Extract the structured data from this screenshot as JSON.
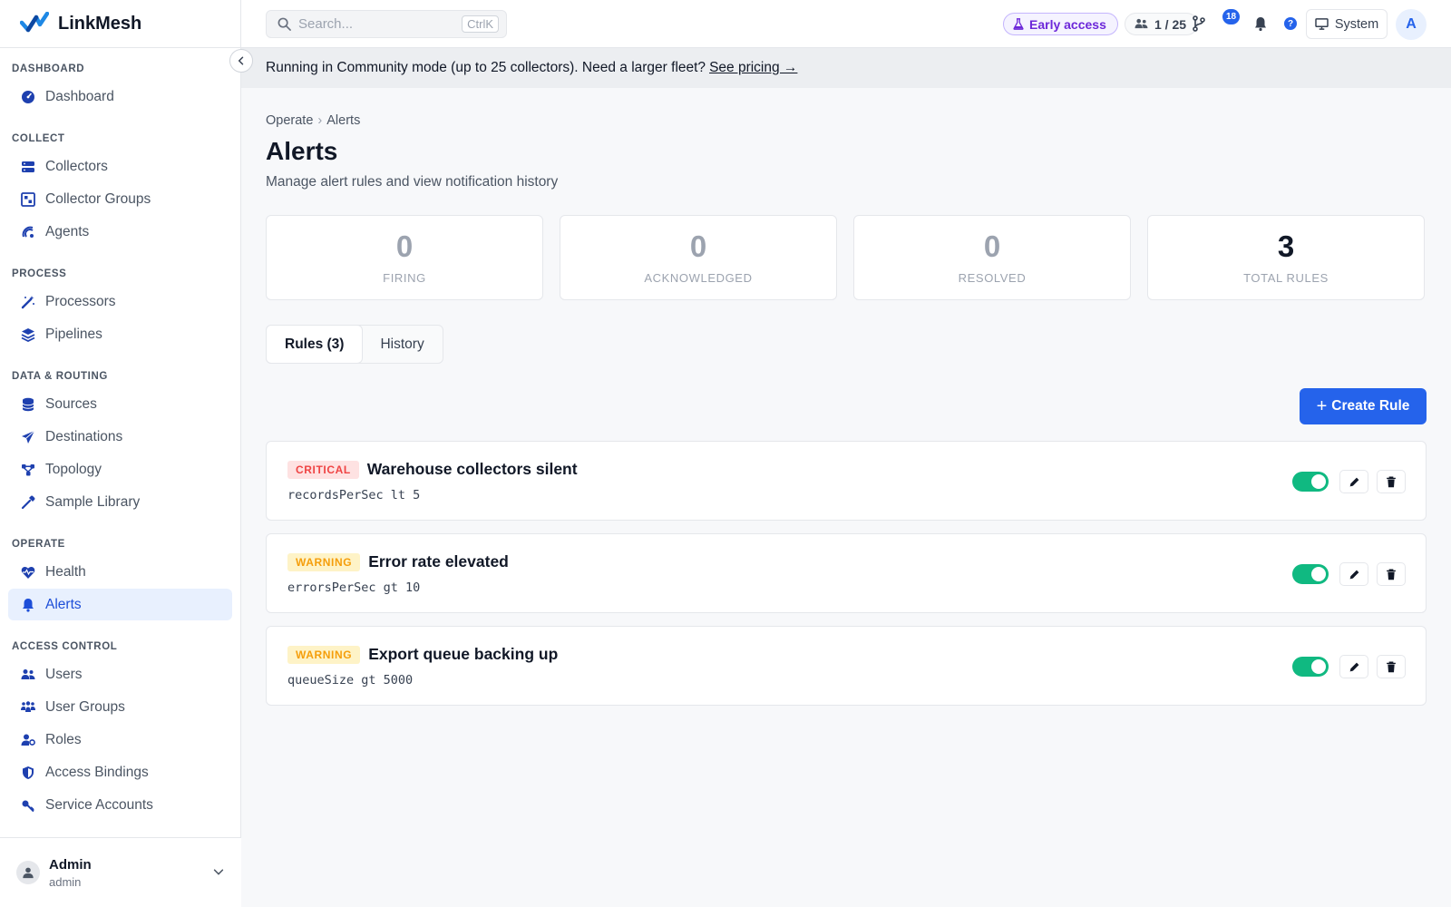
{
  "app": {
    "name": "LinkMesh"
  },
  "sidebar": {
    "sections": [
      {
        "label": "DASHBOARD",
        "items": [
          {
            "label": "Dashboard",
            "icon": "gauge-icon"
          }
        ]
      },
      {
        "label": "COLLECT",
        "items": [
          {
            "label": "Collectors",
            "icon": "server-icon"
          },
          {
            "label": "Collector Groups",
            "icon": "group-frame-icon"
          },
          {
            "label": "Agents",
            "icon": "agent-icon"
          }
        ]
      },
      {
        "label": "PROCESS",
        "items": [
          {
            "label": "Processors",
            "icon": "magic-wand-icon"
          },
          {
            "label": "Pipelines",
            "icon": "layers-icon"
          }
        ]
      },
      {
        "label": "DATA & ROUTING",
        "items": [
          {
            "label": "Sources",
            "icon": "database-icon"
          },
          {
            "label": "Destinations",
            "icon": "paper-plane-icon"
          },
          {
            "label": "Topology",
            "icon": "topology-icon"
          },
          {
            "label": "Sample Library",
            "icon": "eyedropper-icon"
          }
        ]
      },
      {
        "label": "OPERATE",
        "items": [
          {
            "label": "Health",
            "icon": "heart-pulse-icon"
          },
          {
            "label": "Alerts",
            "icon": "bell-icon",
            "active": true
          }
        ]
      },
      {
        "label": "ACCESS CONTROL",
        "items": [
          {
            "label": "Users",
            "icon": "users-icon"
          },
          {
            "label": "User Groups",
            "icon": "user-groups-icon"
          },
          {
            "label": "Roles",
            "icon": "user-key-icon"
          },
          {
            "label": "Access Bindings",
            "icon": "shield-icon"
          },
          {
            "label": "Service Accounts",
            "icon": "key-icon"
          }
        ]
      }
    ],
    "footer": {
      "name": "Admin",
      "username": "admin"
    }
  },
  "topbar": {
    "search_placeholder": "Search...",
    "search_shortcut": "CtrlK",
    "early_access": "Early access",
    "seats": "1 / 25",
    "branch_badge": "18",
    "help_glyph": "?",
    "theme_label": "System",
    "avatar_initial": "A"
  },
  "banner": {
    "text": "Running in Community mode (up to 25 collectors). Need a larger fleet?",
    "link": "See pricing →"
  },
  "breadcrumb": {
    "parent": "Operate",
    "sep": "›",
    "current": "Alerts"
  },
  "page": {
    "title": "Alerts",
    "subtitle": "Manage alert rules and view notification history"
  },
  "stats": [
    {
      "value": "0",
      "label": "FIRING"
    },
    {
      "value": "0",
      "label": "ACKNOWLEDGED"
    },
    {
      "value": "0",
      "label": "RESOLVED"
    },
    {
      "value": "3",
      "label": "TOTAL RULES"
    }
  ],
  "tabs": [
    {
      "label": "Rules (3)",
      "active": true
    },
    {
      "label": "History",
      "active": false
    }
  ],
  "create_button": {
    "plus": "+",
    "label": "Create Rule"
  },
  "rules": [
    {
      "severity": "CRITICAL",
      "severity_kind": "critical",
      "name": "Warehouse collectors silent",
      "condition": "recordsPerSec lt 5",
      "enabled": true
    },
    {
      "severity": "WARNING",
      "severity_kind": "warning",
      "name": "Error rate elevated",
      "condition": "errorsPerSec gt 10",
      "enabled": true
    },
    {
      "severity": "WARNING",
      "severity_kind": "warning",
      "name": "Export queue backing up",
      "condition": "queueSize gt 5000",
      "enabled": true
    }
  ],
  "colors": {
    "accent": "#2563eb",
    "toggle_on": "#10b981",
    "critical": "#ef4444",
    "warning": "#f59e0b"
  }
}
